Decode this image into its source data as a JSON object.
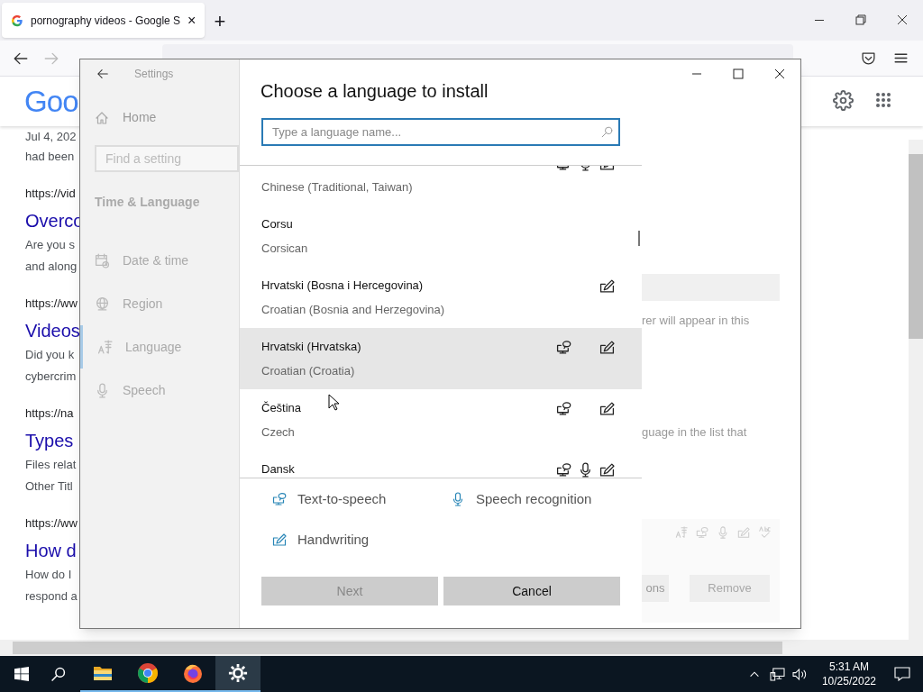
{
  "browser": {
    "tab": {
      "title": "pornography videos - Google S",
      "close": "×"
    },
    "new_tab": "+"
  },
  "google": {
    "logo": "Goo"
  },
  "results": [
    {
      "snippet": [
        "Jul 4, 202",
        "had been"
      ]
    },
    {
      "url": "https://vid",
      "title": "Overco",
      "snippet": [
        "Are you s",
        "and along"
      ]
    },
    {
      "url": "https://ww",
      "title": "Videos",
      "snippet": [
        "Did you k",
        "cybercrim"
      ]
    },
    {
      "url": "https://na",
      "title": "Types",
      "snippet": [
        "Files relat",
        "Other Titl"
      ]
    },
    {
      "url": "https://ww",
      "title": "How d",
      "snippet": [
        "How do I",
        "respond a"
      ]
    }
  ],
  "settings": {
    "title": "Settings",
    "home": "Home",
    "search": {
      "placeholder": "Find a setting"
    },
    "section": "Time & Language",
    "nav": [
      {
        "kind": "calendar",
        "label": "Date & time",
        "selected": false
      },
      {
        "kind": "globe",
        "label": "Region",
        "selected": false
      },
      {
        "kind": "language",
        "label": "Language",
        "selected": true
      },
      {
        "kind": "mic",
        "label": "Speech",
        "selected": false
      }
    ],
    "background_texts": [
      "rer will appear in this",
      "guage in the list that"
    ],
    "background_buttons": [
      {
        "label": "ons",
        "disabled": false
      },
      {
        "label": "Remove",
        "disabled": true
      }
    ]
  },
  "dialog": {
    "title": "Choose a language to install",
    "search": {
      "placeholder": "Type a language name..."
    },
    "languages": [
      {
        "english": "Chinese (Traditional, Taiwan)",
        "text_to_speech": true,
        "speech_recognition": true,
        "handwriting": true,
        "selected": false
      },
      {
        "native": "Corsu",
        "english": "Corsican",
        "text_to_speech": false,
        "speech_recognition": false,
        "handwriting": false,
        "selected": false
      },
      {
        "native": "Hrvatski (Bosna i Hercegovina)",
        "english": "Croatian (Bosnia and Herzegovina)",
        "text_to_speech": false,
        "speech_recognition": false,
        "handwriting": true,
        "selected": false
      },
      {
        "native": "Hrvatski (Hrvatska)",
        "english": "Croatian (Croatia)",
        "text_to_speech": true,
        "speech_recognition": false,
        "handwriting": true,
        "selected": true
      },
      {
        "native": "Čeština",
        "english": "Czech",
        "text_to_speech": true,
        "speech_recognition": false,
        "handwriting": true,
        "selected": false
      },
      {
        "native": "Dansk",
        "text_to_speech": true,
        "speech_recognition": true,
        "handwriting": true,
        "selected": false
      }
    ],
    "legend": [
      {
        "kind": "text_to_speech",
        "label": "Text-to-speech"
      },
      {
        "kind": "speech_recognition",
        "label": "Speech recognition"
      },
      {
        "kind": "handwriting",
        "label": "Handwriting"
      }
    ],
    "buttons": [
      {
        "label": "Next",
        "disabled": true
      },
      {
        "label": "Cancel",
        "disabled": false
      }
    ]
  },
  "taskbar": {
    "apps": [
      {
        "kind": "explorer",
        "running": true,
        "selected": false
      },
      {
        "kind": "chrome",
        "running": true,
        "selected": false
      },
      {
        "kind": "firefox",
        "running": true,
        "selected": false
      },
      {
        "kind": "settings",
        "running": true,
        "selected": true
      }
    ],
    "time": "5:31 AM",
    "date": "10/25/2022"
  }
}
